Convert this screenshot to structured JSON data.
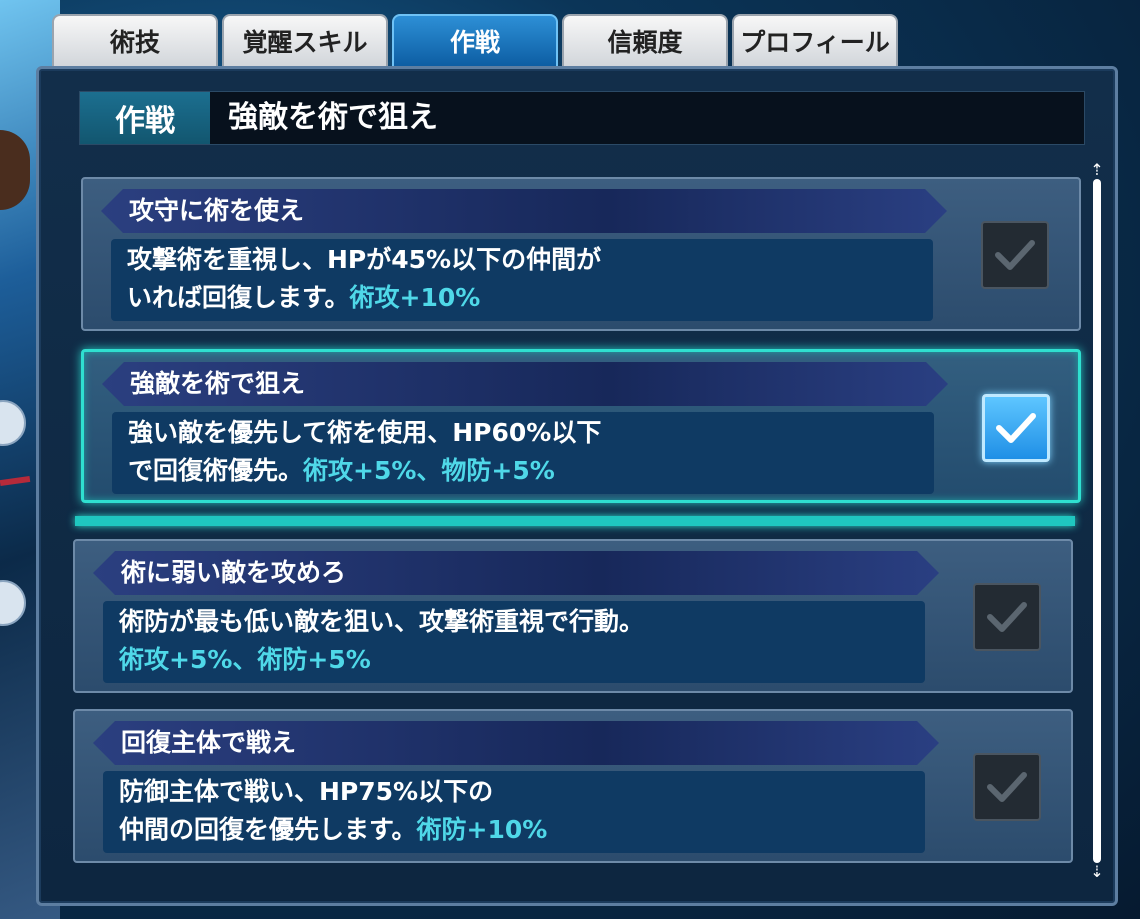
{
  "tabs": [
    {
      "label": "術技"
    },
    {
      "label": "覚醒スキル"
    },
    {
      "label": "作戦"
    },
    {
      "label": "信頼度"
    },
    {
      "label": "プロフィール"
    }
  ],
  "active_tab": "作戦",
  "header": {
    "label": "作戦",
    "value": "強敵を術で狙え"
  },
  "strategies": [
    {
      "title": "攻守に術を使え",
      "desc_line1": "攻撃術を重視し、HPが45%以下の仲間が",
      "desc_line2": "いれば回復します。",
      "bonus": "術攻+10%",
      "checked": false
    },
    {
      "title": "強敵を術で狙え",
      "desc_line1": "強い敵を優先して術を使用、HP60%以下",
      "desc_line2": "で回復術優先。",
      "bonus": "術攻+5%、物防+5%",
      "checked": true
    },
    {
      "title": "術に弱い敵を攻めろ",
      "desc_line1": "術防が最も低い敵を狙い、攻撃術重視で行動。",
      "desc_line2": "",
      "bonus": "術攻+5%、術防+5%",
      "checked": false
    },
    {
      "title": "回復主体で戦え",
      "desc_line1": "防御主体で戦い、HP75%以下の",
      "desc_line2": "仲間の回復を優先します。",
      "bonus": "術防+10%",
      "checked": false
    }
  ],
  "colors": {
    "accent_selected": "#2fe0d0",
    "bonus_text": "#4fd8e8",
    "active_tab": "#1a78c2"
  }
}
